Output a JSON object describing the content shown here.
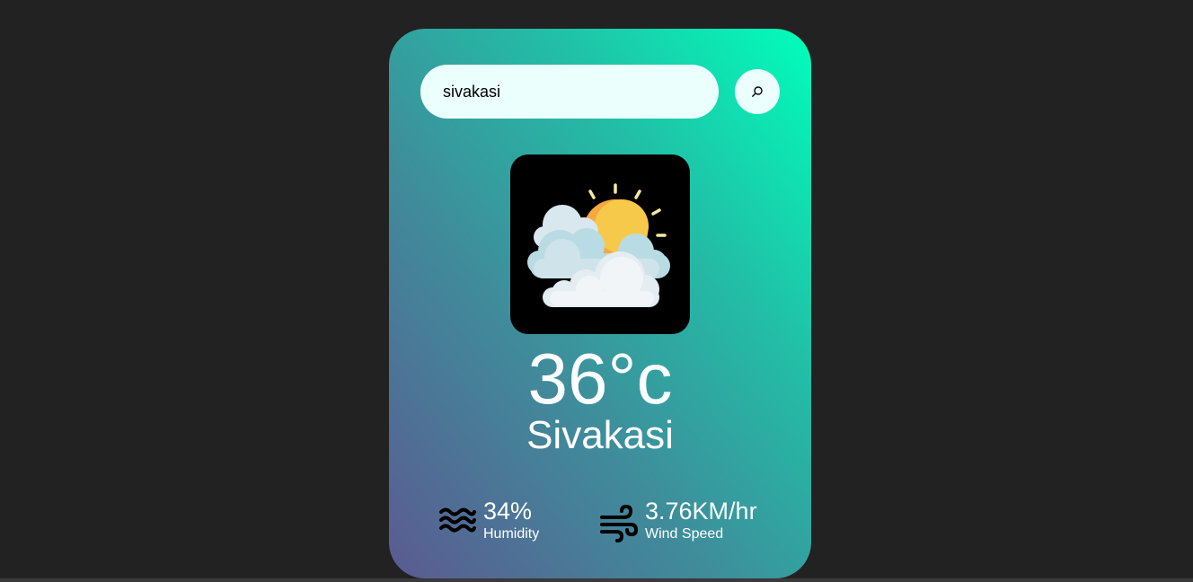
{
  "search": {
    "value": "sivakasi",
    "placeholder": "",
    "button_icon": "search-icon"
  },
  "weather": {
    "icon": "partly-cloudy-icon",
    "temperature": "36°c",
    "city": "Sivakasi"
  },
  "details": {
    "humidity": {
      "icon": "humidity-waves-icon",
      "value": "34%",
      "label": "Humidity"
    },
    "wind": {
      "icon": "wind-icon",
      "value": "3.76KM/hr",
      "label": "Wind Speed"
    }
  },
  "colors": {
    "background": "#222222",
    "card_gradient_start": "#5b5a91",
    "card_gradient_end": "#00ffbb",
    "input_background": "#ebfffc",
    "text": "#ffffff"
  }
}
